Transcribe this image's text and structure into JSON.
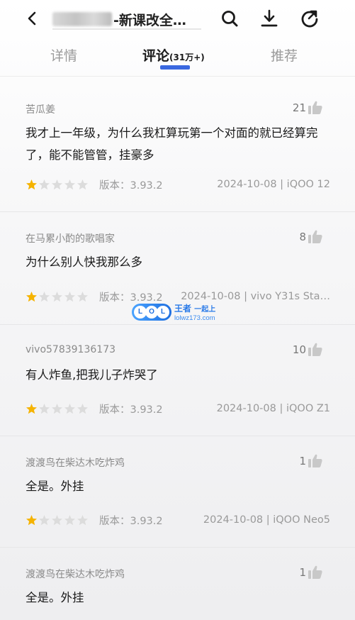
{
  "header": {
    "title_suffix": "-新课改全…",
    "icons": [
      "back-icon",
      "search-icon",
      "download-icon",
      "share-icon"
    ]
  },
  "tabs": [
    {
      "label": "详情",
      "active": false
    },
    {
      "label": "评论",
      "count": "(31万+)",
      "active": true
    },
    {
      "label": "推荐",
      "active": false
    }
  ],
  "accent_color": "#3a68e0",
  "star_color": "#f5b300",
  "reviews": [
    {
      "user": "苦瓜姜",
      "likes": "21",
      "text": "我才上一年级，为什么我杠算玩第一个对面的就已经算完了，能不能管管，挂豪多",
      "rating": 1,
      "version": "版本：3.93.2",
      "date_device": "2024-10-08 | iQOO 12"
    },
    {
      "user": "在马累小酌的歌唱家",
      "likes": "8",
      "text": "为什么别人快我那么多",
      "rating": 1,
      "version": "版本：3.93.2",
      "date_device": "2024-10-08 | vivo Y31s Sta…"
    },
    {
      "user": "vivo57839136173",
      "likes": "10",
      "text": "有人炸鱼,把我儿子炸哭了",
      "rating": 1,
      "version": "版本：3.93.2",
      "date_device": "2024-10-08 | iQOO Z1"
    },
    {
      "user": "渡渡鸟在柴达木吃炸鸡",
      "likes": "1",
      "text": "全是。外挂",
      "rating": 1,
      "version": "版本：3.93.2",
      "date_device": "2024-10-08 | iQOO Neo5"
    },
    {
      "user": "渡渡鸟在柴达木吃炸鸡",
      "likes": "1",
      "text": "全是。外挂"
    }
  ],
  "watermark": {
    "badge": "LOL",
    "title": "王者",
    "title_small": "一起上",
    "url": "lolwz173.com"
  }
}
